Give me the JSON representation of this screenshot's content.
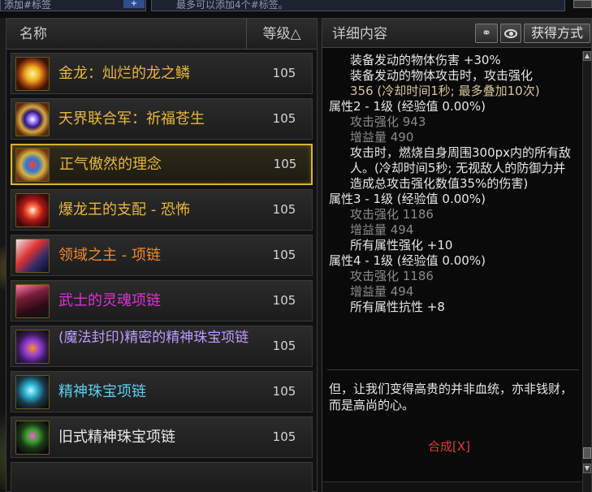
{
  "top_bar": {
    "tag_field": "添加#标签",
    "tag_add_glyph": "+",
    "tag_hint": "最多可以添加4个#标签。"
  },
  "list": {
    "col_name": "名称",
    "col_level": "等级△",
    "items": [
      {
        "name": "金龙：灿烂的龙之鳞",
        "level": "105",
        "color": "#e8b63a",
        "icon": "gold-dragon-scale-icon"
      },
      {
        "name": "天界联合军：祈福苍生",
        "level": "105",
        "color": "#e8b63a",
        "icon": "sky-alliance-icon"
      },
      {
        "name": "正气傲然的理念",
        "level": "105",
        "color": "#e8b63a",
        "icon": "righteous-spirit-icon"
      },
      {
        "name": "爆龙王的支配 - 恐怖",
        "level": "105",
        "color": "#e8b63a",
        "icon": "dragon-king-icon"
      },
      {
        "name": "领域之主 - 项链",
        "level": "105",
        "color": "#f08a2a",
        "icon": "domain-lord-necklace-icon"
      },
      {
        "name": "武士的灵魂项链",
        "level": "105",
        "color": "#e02fd8",
        "icon": "samurai-soul-necklace-icon"
      },
      {
        "name": "(魔法封印)精密的精神珠宝项链",
        "level": "105",
        "color": "#b89cff",
        "icon": "sealed-spirit-jewel-necklace-icon"
      },
      {
        "name": "精神珠宝项链",
        "level": "105",
        "color": "#5ad0f0",
        "icon": "spirit-jewel-necklace-icon"
      },
      {
        "name": "旧式精神珠宝项链",
        "level": "105",
        "color": "#e8e8e8",
        "icon": "old-spirit-jewel-necklace-icon"
      }
    ]
  },
  "detail_panel": {
    "title": "详细内容",
    "compare_icon": "compare-icon",
    "view_icon": "eye-icon",
    "obtain_button": "获得方式",
    "lines": [
      {
        "text": "装备发动的物体伤害 +30%",
        "color": "white",
        "indent": 2
      },
      {
        "text": "装备发动的物体攻击时，攻击强化",
        "color": "white",
        "indent": 2
      },
      {
        "text": "356 (冷却时间1秒; 最多叠加10次)",
        "color": "gold",
        "indent": 2
      },
      {
        "text": "属性2 - 1级 (经验值 0.00%)",
        "color": "white",
        "indent": 1
      },
      {
        "text": "攻击强化 943",
        "color": "grey",
        "indent": 2
      },
      {
        "text": "增益量 490",
        "color": "grey",
        "indent": 2
      },
      {
        "text": "攻击时，燃烧自身周围300px内的所有敌人。(冷却时间5秒; 无视敌人的防御力并造成总攻击强化数值35%的伤害)",
        "color": "white",
        "indent": 3
      },
      {
        "text": "属性3 - 1级 (经验值 0.00%)",
        "color": "white",
        "indent": 1
      },
      {
        "text": "攻击强化 1186",
        "color": "grey",
        "indent": 2
      },
      {
        "text": "增益量 494",
        "color": "grey",
        "indent": 2
      },
      {
        "text": "所有属性强化 +10",
        "color": "white",
        "indent": 2
      },
      {
        "text": "属性4 - 1级 (经验值 0.00%)",
        "color": "white",
        "indent": 1
      },
      {
        "text": "攻击强化 1186",
        "color": "grey",
        "indent": 2
      },
      {
        "text": "增益量 494",
        "color": "grey",
        "indent": 2
      },
      {
        "text": "所有属性抗性 +8",
        "color": "white",
        "indent": 2
      }
    ],
    "flavor_text": "但，让我们变得高贵的并非血统，亦非钱财，而是高尚的心。",
    "craft_link": "合成[X]",
    "scroll_up_glyph": "▲",
    "scroll_down_glyph": "▼"
  }
}
